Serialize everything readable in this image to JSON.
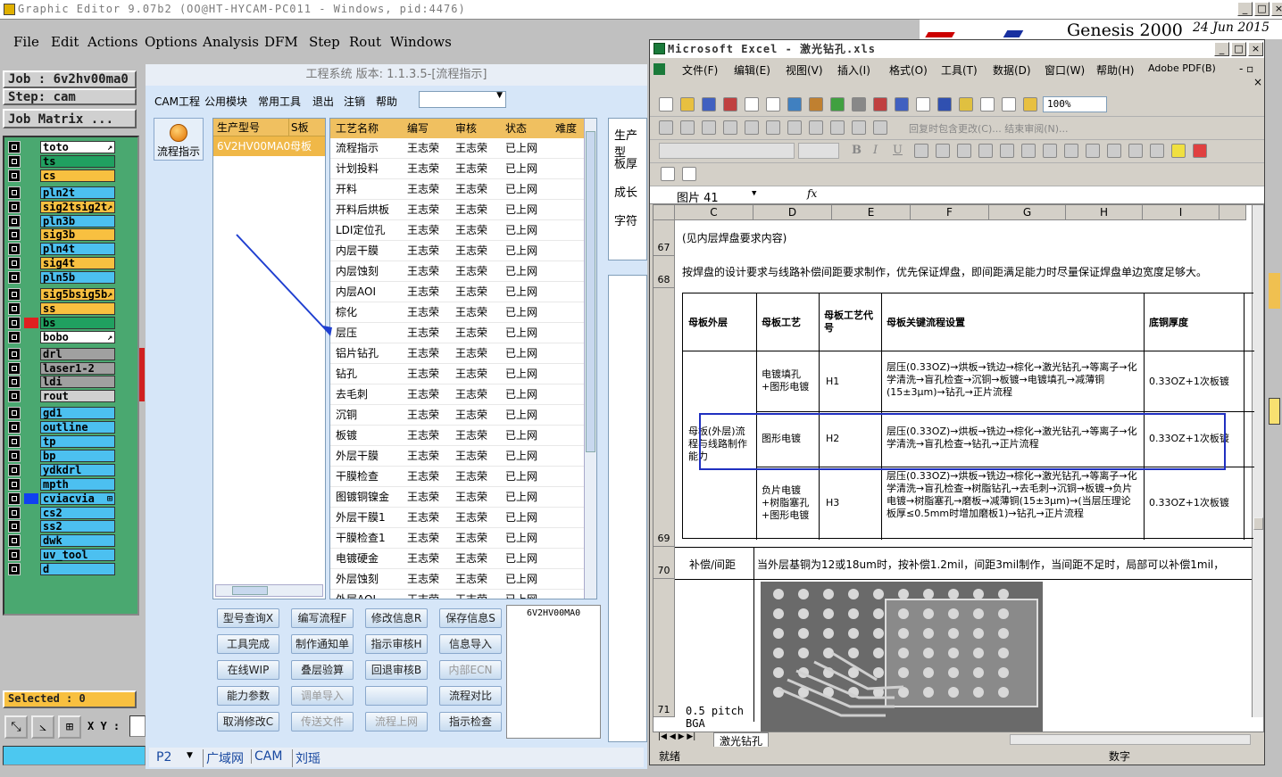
{
  "app": {
    "title": "Graphic Editor 9.07b2 (OO@HT-HYCAM-PC011 - Windows, pid:4476)",
    "menu": [
      "File",
      "Edit",
      "Actions",
      "Options",
      "Analysis",
      "DFM",
      "Step",
      "Rout",
      "Windows"
    ]
  },
  "genesis": {
    "title": "Genesis 2000",
    "date": "24 Jun 2015"
  },
  "job": {
    "job": "Job : 6v2hv00ma0",
    "step": "Step: cam",
    "matrix": "Job Matrix ...",
    "selected": "Selected : 0",
    "xy": "X Y :"
  },
  "layers": [
    {
      "name": "to",
      "color": "#ffffff",
      "mark": "↗"
    },
    {
      "name": "ts",
      "color": "#20a060",
      "mark": ""
    },
    {
      "name": "cs",
      "color": "#f8c040",
      "mark": ""
    },
    {
      "name": "pln2t",
      "color": "#4cc0f0",
      "mark": ""
    },
    {
      "name": "sig2t",
      "color": "#f8c040",
      "mark": "↗"
    },
    {
      "name": "pln3b",
      "color": "#4cc0f0",
      "mark": ""
    },
    {
      "name": "sig3b",
      "color": "#f8c040",
      "mark": ""
    },
    {
      "name": "pln4t",
      "color": "#4cc0f0",
      "mark": ""
    },
    {
      "name": "sig4t",
      "color": "#f8c040",
      "mark": ""
    },
    {
      "name": "pln5b",
      "color": "#4cc0f0",
      "mark": ""
    },
    {
      "name": "sig5b",
      "color": "#f8c040",
      "mark": "↗"
    },
    {
      "name": "ss",
      "color": "#f8c040",
      "mark": ""
    },
    {
      "name": "bs",
      "color": "#20a060",
      "mark": ""
    },
    {
      "name": "bo",
      "color": "#ffffff",
      "mark": "↗"
    },
    {
      "name": "drl",
      "color": "#a0a0a0",
      "mark": ""
    },
    {
      "name": "laser1-2",
      "color": "#a0a0a0",
      "mark": ""
    },
    {
      "name": "ldi",
      "color": "#a0a0a0",
      "mark": ""
    },
    {
      "name": "rout",
      "color": "#d0d0d0",
      "mark": ""
    },
    {
      "name": "gd1",
      "color": "#4cc0f0",
      "mark": ""
    },
    {
      "name": "outline",
      "color": "#4cc0f0",
      "mark": ""
    },
    {
      "name": "tp",
      "color": "#4cc0f0",
      "mark": ""
    },
    {
      "name": "bp",
      "color": "#4cc0f0",
      "mark": ""
    },
    {
      "name": "ydkdrl",
      "color": "#4cc0f0",
      "mark": ""
    },
    {
      "name": "mpth",
      "color": "#4cc0f0",
      "mark": ""
    },
    {
      "name": "cvia",
      "color": "#4cc0f0",
      "mark": "⊞"
    },
    {
      "name": "cs2",
      "color": "#4cc0f0",
      "mark": ""
    },
    {
      "name": "ss2",
      "color": "#4cc0f0",
      "mark": ""
    },
    {
      "name": "dwk",
      "color": "#4cc0f0",
      "mark": ""
    },
    {
      "name": "uv_tool",
      "color": "#4cc0f0",
      "mark": ""
    },
    {
      "name": "d",
      "color": "#4cc0f0",
      "mark": ""
    }
  ],
  "cam": {
    "header": "工程系统 版本: 1.1.3.5-[流程指示]",
    "toolbar": [
      "CAM工程",
      "公用模块",
      "常用工具",
      "退出",
      "注销",
      "帮助"
    ],
    "flow_btn": "流程指示",
    "model_cols": [
      "生产型号",
      "S板"
    ],
    "model_row": [
      "6V2HV00MA0",
      "母板"
    ],
    "proc_cols": [
      "工艺名称",
      "编写",
      "审核",
      "状态",
      "难度"
    ],
    "processes": [
      "流程指示",
      "计划投料",
      "开料",
      "开料后烘板",
      "LDI定位孔",
      "内层干膜",
      "内层蚀刻",
      "内层AOI",
      "棕化",
      "层压",
      "铝片钻孔",
      "钻孔",
      "去毛刺",
      "沉铜",
      "板镀",
      "外层干膜",
      "干膜检查",
      "图镀铜镍金",
      "外层干膜1",
      "干膜检查1",
      "电镀硬金",
      "外层蚀刻",
      "外层AOI"
    ],
    "writer": "王志荣",
    "reviewer": "王志荣",
    "state": "已上网",
    "side_labels": [
      "生产型",
      "板厚",
      "成长",
      "字符"
    ],
    "buttons": [
      [
        "型号查询X",
        "编写流程F",
        "修改信息R",
        "保存信息S"
      ],
      [
        "工具完成",
        "制作通知单",
        "指示审核H",
        "信息导入"
      ],
      [
        "在线WIP",
        "叠层验算",
        "回退审核B",
        "内部ECN"
      ],
      [
        "能力参数",
        "调单导入",
        "",
        "流程对比"
      ],
      [
        "取消修改C",
        "传送文件",
        "流程上网",
        "指示检查"
      ]
    ],
    "note": "6V2HV00MA0",
    "tabs": [
      "P2",
      "广域网",
      "CAM",
      "刘瑶"
    ]
  },
  "excel": {
    "title": "Microsoft Excel - 激光钻孔.xls",
    "menu": [
      "文件(F)",
      "编辑(E)",
      "视图(V)",
      "插入(I)",
      "格式(O)",
      "工具(T)",
      "数据(D)",
      "窗口(W)",
      "帮助(H)",
      "Adobe PDF(B)"
    ],
    "reply": "回复时包含更改(C)... 结束审阅(N)...",
    "zoom": "100%",
    "namebox": "图片 41",
    "fx": "fx",
    "cols": [
      "C",
      "D",
      "E",
      "F",
      "G",
      "H",
      "I"
    ],
    "row67": "(见内层焊盘要求内容)",
    "row68": "按焊盘的设计要求与线路补偿间距要求制作，优先保证焊盘，即间距满足能力时尽量保证焊盘单边宽度足够大。",
    "table_head": [
      "母板外层",
      "母板工艺",
      "母板工艺代号",
      "母板关键流程设置",
      "底铜厚度"
    ],
    "side_label": "母板(外层)流程与线路制作能力",
    "rows": [
      {
        "proc": "电镀填孔+图形电镀",
        "code": "H1",
        "flow": "层压(0.33OZ)→烘板→铣边→棕化→激光钻孔→等离子→化学清洗→盲孔检查→沉铜→板镀→电镀填孔→减薄铜(15±3μm)→钻孔→正片流程",
        "cu": "0.33OZ+1次板镀"
      },
      {
        "proc": "图形电镀",
        "code": "H2",
        "flow": "层压(0.33OZ)→烘板→铣边→棕化→激光钻孔→等离子→化学清洗→盲孔检查→钻孔→正片流程",
        "cu": "0.33OZ+1次板镀"
      },
      {
        "proc": "负片电镀+树脂塞孔+图形电镀",
        "code": "H3",
        "flow": "层压(0.33OZ)→烘板→铣边→棕化→激光钻孔→等离子→化学清洗→盲孔检查→树脂钻孔→去毛刺→沉铜→板镀→负片电镀→树脂塞孔→磨板→减薄铜(15±3μm)→(当层压理论板厚≤0.5mm时增加磨板1)→钻孔→正片流程",
        "cu": "0.33OZ+1次板镀"
      }
    ],
    "row70_label": "补偿/间距",
    "row70": "当外层基铜为12或18um时，按补偿1.2mil，间距3mil制作，当间距不足时，局部可以补偿1mil，",
    "row71_label": "0.5 pitch BGA",
    "sheet_tab": "激光钻孔",
    "status_left": "就绪",
    "status_right": "数字",
    "row_nums": [
      "67",
      "68",
      "69",
      "70",
      "71"
    ]
  }
}
